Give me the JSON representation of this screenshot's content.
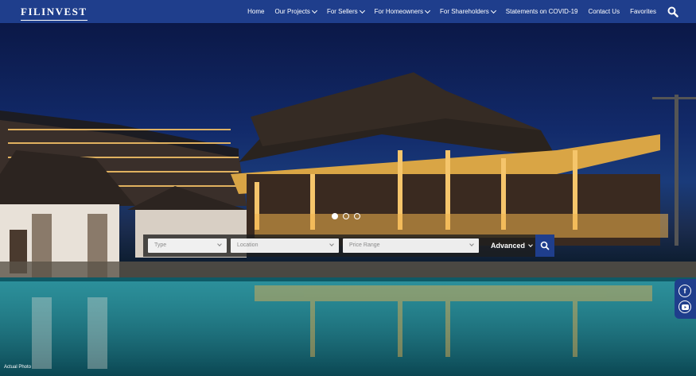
{
  "header": {
    "logo": "FILINVEST",
    "nav": [
      {
        "label": "Home",
        "dropdown": false
      },
      {
        "label": "Our Projects",
        "dropdown": true
      },
      {
        "label": "For Sellers",
        "dropdown": true
      },
      {
        "label": "For Homeowners",
        "dropdown": true
      },
      {
        "label": "For Shareholders",
        "dropdown": true
      },
      {
        "label": "Statements on COVID-19",
        "dropdown": false
      },
      {
        "label": "Contact Us",
        "dropdown": false
      },
      {
        "label": "Favorites",
        "dropdown": false
      }
    ],
    "search_icon": "search-icon",
    "color": "#1f3e8c"
  },
  "hero": {
    "slider_dots": 3,
    "active_slide": 1,
    "caption": "Actual Photo"
  },
  "search": {
    "type_placeholder": "Type",
    "location_placeholder": "Location",
    "price_placeholder": "Price Range",
    "advanced_label": "Advanced"
  },
  "social": {
    "facebook": "f",
    "youtube": "youtube-icon"
  }
}
